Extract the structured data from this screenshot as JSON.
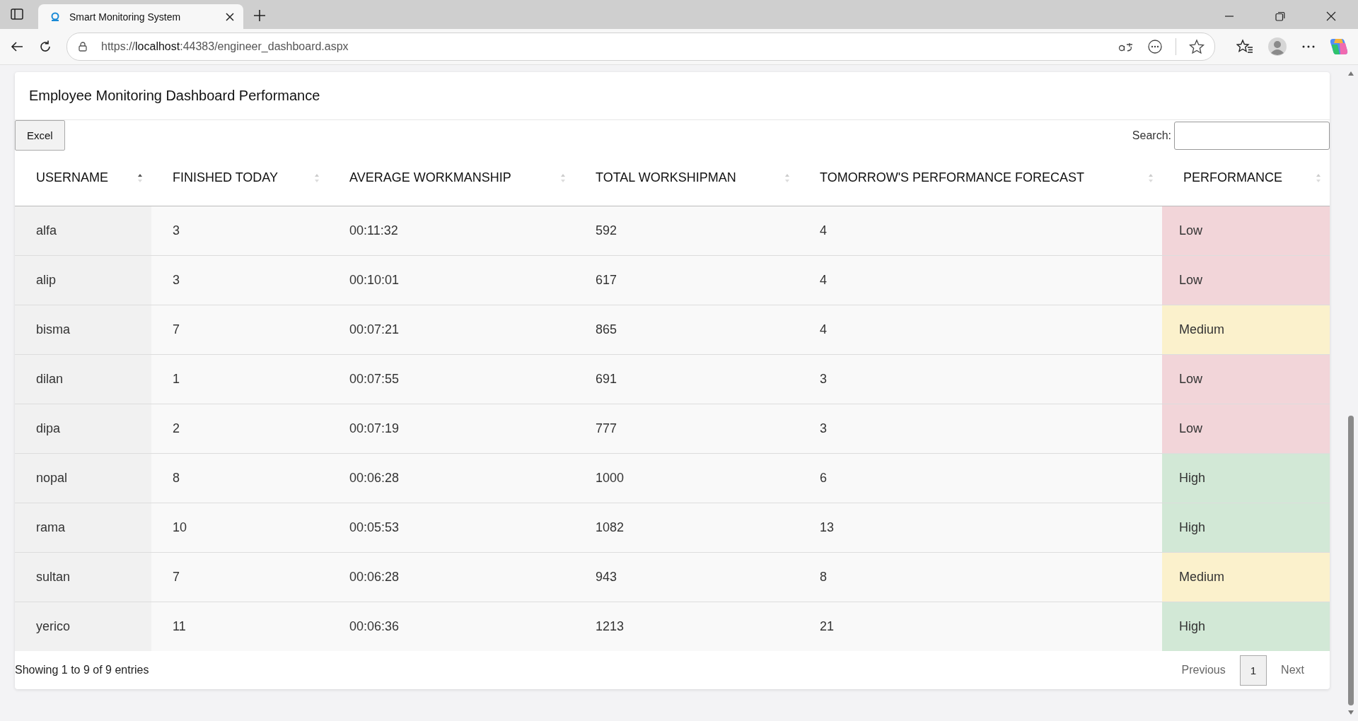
{
  "browser": {
    "tab_title": "Smart Monitoring System",
    "url_prefix": "https://",
    "url_host": "localhost",
    "url_rest": ":44383/engineer_dashboard.aspx"
  },
  "card": {
    "title": "Employee Monitoring Dashboard Performance",
    "export_button": "Excel",
    "search": {
      "label": "Search:"
    }
  },
  "table": {
    "columns": [
      {
        "label": "USERNAME",
        "sorted": true
      },
      {
        "label": "FINISHED TODAY",
        "sorted": false
      },
      {
        "label": "AVERAGE WORKMANSHIP",
        "sorted": false
      },
      {
        "label": "TOTAL WORKSHIPMAN",
        "sorted": false
      },
      {
        "label": "TOMORROW'S PERFORMANCE FORECAST",
        "sorted": false
      },
      {
        "label": "PERFORMANCE",
        "sorted": false
      }
    ],
    "rows": [
      {
        "cells": [
          "alfa",
          "3",
          "00:11:32",
          "592",
          "4"
        ],
        "performance": "Low",
        "kind": "low"
      },
      {
        "cells": [
          "alip",
          "3",
          "00:10:01",
          "617",
          "4"
        ],
        "performance": "Low",
        "kind": "low"
      },
      {
        "cells": [
          "bisma",
          "7",
          "00:07:21",
          "865",
          "4"
        ],
        "performance": "Medium",
        "kind": "medium"
      },
      {
        "cells": [
          "dilan",
          "1",
          "00:07:55",
          "691",
          "3"
        ],
        "performance": "Low",
        "kind": "low"
      },
      {
        "cells": [
          "dipa",
          "2",
          "00:07:19",
          "777",
          "3"
        ],
        "performance": "Low",
        "kind": "low"
      },
      {
        "cells": [
          "nopal",
          "8",
          "00:06:28",
          "1000",
          "6"
        ],
        "performance": "High",
        "kind": "high"
      },
      {
        "cells": [
          "rama",
          "10",
          "00:05:53",
          "1082",
          "13"
        ],
        "performance": "High",
        "kind": "high"
      },
      {
        "cells": [
          "sultan",
          "7",
          "00:06:28",
          "943",
          "8"
        ],
        "performance": "Medium",
        "kind": "medium"
      },
      {
        "cells": [
          "yerico",
          "11",
          "00:06:36",
          "1213",
          "21"
        ],
        "performance": "High",
        "kind": "high"
      }
    ]
  },
  "footer": {
    "info": "Showing 1 to 9 of 9 entries",
    "pagination": {
      "previous": "Previous",
      "pages": [
        {
          "label": "1",
          "selected": true
        }
      ],
      "next": "Next"
    }
  }
}
